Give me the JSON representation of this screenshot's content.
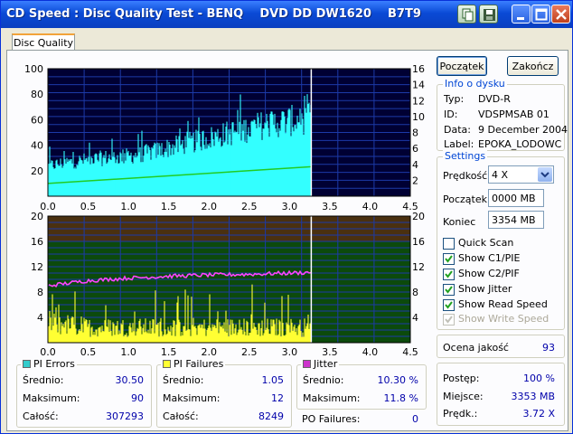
{
  "window": {
    "title": "CD Speed : Disc Quality Test - BENQ    DVD DD DW1620    B7T9",
    "tab": "Disc Quality"
  },
  "buttons": {
    "start": "Początek",
    "stop": "Zakończ"
  },
  "disc_info": {
    "title": "Info o dysku",
    "rows": [
      {
        "label": "Typ:",
        "value": "DVD-R"
      },
      {
        "label": "ID:",
        "value": "VDSPMSAB 01"
      },
      {
        "label": "Data:",
        "value": "9 December 2004"
      },
      {
        "label": "Label:",
        "value": "EPOKA_LODOWC"
      }
    ]
  },
  "settings": {
    "title": "Settings",
    "speed_label": "Prędkość",
    "speed_value": "4 X",
    "start_label": "Początek",
    "start_value": "0000 MB",
    "end_label": "Koniec",
    "end_value": "3354 MB",
    "checkboxes": [
      {
        "label": "Quick Scan",
        "checked": false,
        "enabled": true
      },
      {
        "label": "Show C1/PIE",
        "checked": true,
        "enabled": true
      },
      {
        "label": "Show C2/PIF",
        "checked": true,
        "enabled": true
      },
      {
        "label": "Show Jitter",
        "checked": true,
        "enabled": true
      },
      {
        "label": "Show Read Speed",
        "checked": true,
        "enabled": true
      },
      {
        "label": "Show Write Speed",
        "checked": true,
        "enabled": false
      }
    ]
  },
  "quality": {
    "label": "Ocena jakość",
    "value": "93"
  },
  "progress": {
    "rows": [
      {
        "label": "Postęp:",
        "value": "100 %"
      },
      {
        "label": "Miejsce:",
        "value": "3353 MB"
      },
      {
        "label": "Prędk.:",
        "value": "3.72 X"
      }
    ]
  },
  "stats": {
    "pi_errors": {
      "title": "PI Errors",
      "color": "#33cccc",
      "rows": [
        {
          "label": "Średnio:",
          "value": "30.50"
        },
        {
          "label": "Maksimum:",
          "value": "90"
        },
        {
          "label": "Całość:",
          "value": "307293"
        }
      ]
    },
    "pi_failures": {
      "title": "PI Failures",
      "color": "#ffff33",
      "rows": [
        {
          "label": "Średnio:",
          "value": "1.05"
        },
        {
          "label": "Maksimum:",
          "value": "12"
        },
        {
          "label": "Całość:",
          "value": "8249"
        }
      ]
    },
    "jitter": {
      "title": "Jitter",
      "color": "#cc33cc",
      "rows": [
        {
          "label": "Średnio:",
          "value": "10.30 %"
        },
        {
          "label": "Maksimum:",
          "value": "11.8 %"
        }
      ]
    },
    "po_failures": {
      "label": "PO Failures:",
      "value": "0"
    }
  },
  "chart_data": [
    {
      "type": "area",
      "name": "PI Errors / Read speed",
      "xlim": [
        0,
        4.5
      ],
      "ylim_left": [
        0,
        100
      ],
      "ylim_right": [
        0,
        16
      ],
      "x_ticks": [
        "0.0",
        "0.5",
        "1.0",
        "1.5",
        "2.0",
        "2.5",
        "3.0",
        "3.5",
        "4.0",
        "4.5"
      ],
      "y_ticks_left": [
        "20",
        "40",
        "60",
        "80",
        "100"
      ],
      "y_ticks_right": [
        "2",
        "4",
        "6",
        "8",
        "10",
        "12",
        "14",
        "16"
      ],
      "series": [
        {
          "name": "PI Errors",
          "color": "#33ffff",
          "x": [
            0.0,
            0.25,
            0.5,
            0.75,
            1.0,
            1.25,
            1.5,
            1.75,
            2.0,
            2.25,
            2.5,
            2.75,
            3.0,
            3.27
          ],
          "values": [
            25,
            28,
            30,
            32,
            33,
            36,
            40,
            44,
            48,
            52,
            56,
            60,
            62,
            65
          ],
          "max": 90
        },
        {
          "name": "Read speed",
          "color": "#22cc22",
          "x": [
            0.0,
            3.27
          ],
          "values": [
            1.6,
            3.7
          ]
        }
      ],
      "end_x": 3.27
    },
    {
      "type": "area",
      "name": "PI Failures / Jitter",
      "xlim": [
        0,
        4.5
      ],
      "ylim": [
        0,
        20
      ],
      "x_ticks": [
        "0.0",
        "0.5",
        "1.0",
        "1.5",
        "2.0",
        "2.5",
        "3.0",
        "3.5",
        "4.0",
        "4.5"
      ],
      "y_ticks_left": [
        "4",
        "8",
        "12",
        "16",
        "20"
      ],
      "y_ticks_right": [
        "4",
        "8",
        "12",
        "16",
        "20"
      ],
      "series": [
        {
          "name": "PI Failures",
          "color": "#ffff33",
          "x": [
            0.0,
            0.5,
            1.0,
            1.5,
            2.0,
            2.5,
            3.0,
            3.27
          ],
          "values": [
            4,
            3,
            3,
            3,
            3,
            3,
            3,
            3
          ],
          "max": 12
        },
        {
          "name": "Jitter",
          "color": "#ff44ff",
          "x": [
            0.0,
            0.5,
            1.0,
            1.5,
            2.0,
            2.5,
            3.0,
            3.27
          ],
          "values": [
            9.0,
            9.8,
            10.2,
            10.5,
            10.7,
            10.8,
            11.0,
            11.1
          ]
        }
      ],
      "end_x": 3.27
    }
  ]
}
